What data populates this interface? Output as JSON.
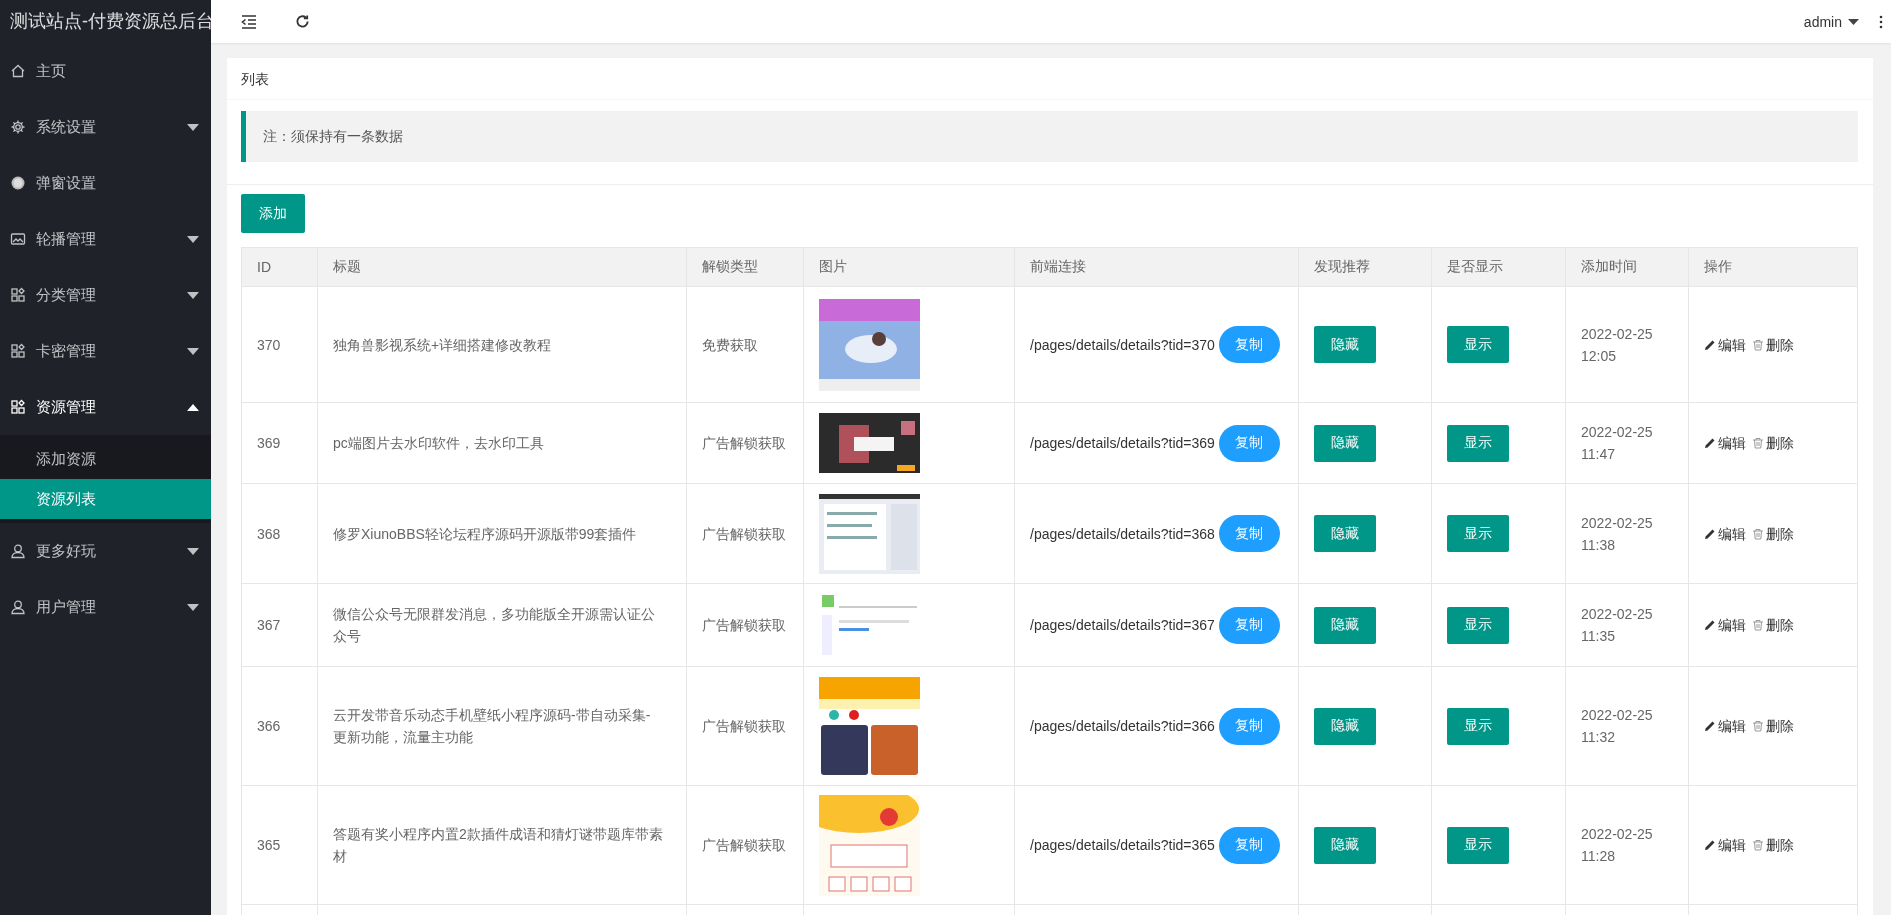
{
  "sidebar": {
    "title": "测试站点-付费资源总后台",
    "items": [
      {
        "label": "主页"
      },
      {
        "label": "系统设置",
        "expanded": false
      },
      {
        "label": "弹窗设置"
      },
      {
        "label": "轮播管理",
        "expanded": false
      },
      {
        "label": "分类管理",
        "expanded": false
      },
      {
        "label": "卡密管理",
        "expanded": false
      },
      {
        "label": "资源管理",
        "expanded": true,
        "children": [
          {
            "label": "添加资源",
            "selected": false
          },
          {
            "label": "资源列表",
            "selected": true
          }
        ]
      },
      {
        "label": "更多好玩",
        "expanded": false
      },
      {
        "label": "用户管理",
        "expanded": false
      }
    ]
  },
  "header": {
    "user": "admin"
  },
  "card": {
    "title": "列表",
    "note": "注：须保持有一条数据",
    "add_button": "添加"
  },
  "table": {
    "columns": [
      "ID",
      "标题",
      "解锁类型",
      "图片",
      "前端连接",
      "发现推荐",
      "是否显示",
      "添加时间",
      "操作"
    ],
    "rows": [
      {
        "id": "370",
        "title": "独角兽影视系统+详细搭建修改教程",
        "unlock": "免费获取",
        "link": "/pages/details/details?tid=370",
        "copy": "复制",
        "recommend": "隐藏",
        "display": "显示",
        "time": "2022-02-25 12:05",
        "edit": "编辑",
        "delete": "删除"
      },
      {
        "id": "369",
        "title": "pc端图片去水印软件，去水印工具",
        "unlock": "广告解锁获取",
        "link": "/pages/details/details?tid=369",
        "copy": "复制",
        "recommend": "隐藏",
        "display": "显示",
        "time": "2022-02-25 11:47",
        "edit": "编辑",
        "delete": "删除"
      },
      {
        "id": "368",
        "title": "修罗XiunoBBS轻论坛程序源码开源版带99套插件",
        "unlock": "广告解锁获取",
        "link": "/pages/details/details?tid=368",
        "copy": "复制",
        "recommend": "隐藏",
        "display": "显示",
        "time": "2022-02-25 11:38",
        "edit": "编辑",
        "delete": "删除"
      },
      {
        "id": "367",
        "title": "微信公众号无限群发消息，多功能版全开源需认证公众号",
        "unlock": "广告解锁获取",
        "link": "/pages/details/details?tid=367",
        "copy": "复制",
        "recommend": "隐藏",
        "display": "显示",
        "time": "2022-02-25 11:35",
        "edit": "编辑",
        "delete": "删除"
      },
      {
        "id": "366",
        "title": "云开发带音乐动态手机壁纸小程序源码-带自动采集-更新功能，流量主功能",
        "unlock": "广告解锁获取",
        "link": "/pages/details/details?tid=366",
        "copy": "复制",
        "recommend": "隐藏",
        "display": "显示",
        "time": "2022-02-25 11:32",
        "edit": "编辑",
        "delete": "删除"
      },
      {
        "id": "365",
        "title": "答题有奖小程序内置2款插件成语和猜灯谜带题库带素材",
        "unlock": "广告解锁获取",
        "link": "/pages/details/details?tid=365",
        "copy": "复制",
        "recommend": "隐藏",
        "display": "显示",
        "time": "2022-02-25 11:28",
        "edit": "编辑",
        "delete": "删除"
      }
    ]
  }
}
